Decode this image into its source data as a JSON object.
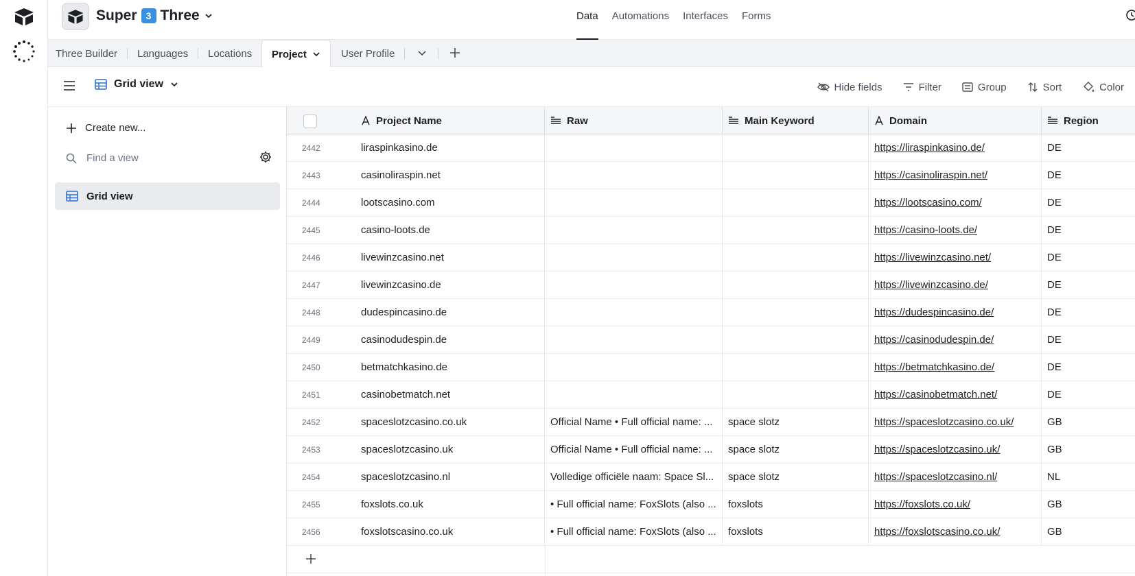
{
  "base": {
    "name_part1": "Super",
    "badge": "3",
    "name_part2": "Three"
  },
  "topnav": [
    "Data",
    "Automations",
    "Interfaces",
    "Forms"
  ],
  "tables": [
    "Three Builder",
    "Languages",
    "Locations",
    "Project",
    "User Profile"
  ],
  "active_table": "Project",
  "view": {
    "name": "Grid view"
  },
  "toolbar": {
    "hide_fields": "Hide fields",
    "filter": "Filter",
    "group": "Group",
    "sort": "Sort",
    "color": "Color"
  },
  "sidebar": {
    "create": "Create new...",
    "find_placeholder": "Find a view",
    "views": [
      "Grid view"
    ]
  },
  "columns": [
    "Project Name",
    "Raw",
    "Main Keyword",
    "Domain",
    "Region"
  ],
  "rows": [
    {
      "id": "2442",
      "name": "liraspinkasino.de",
      "raw": "",
      "kw": "",
      "domain": "https://liraspinkasino.de/",
      "region": "DE"
    },
    {
      "id": "2443",
      "name": "casinoliraspin.net",
      "raw": "",
      "kw": "",
      "domain": "https://casinoliraspin.net/",
      "region": "DE"
    },
    {
      "id": "2444",
      "name": "lootscasino.com",
      "raw": "",
      "kw": "",
      "domain": "https://lootscasino.com/",
      "region": "DE"
    },
    {
      "id": "2445",
      "name": "casino-loots.de",
      "raw": "",
      "kw": "",
      "domain": "https://casino-loots.de/",
      "region": "DE"
    },
    {
      "id": "2446",
      "name": "livewinzcasino.net",
      "raw": "",
      "kw": "",
      "domain": "https://livewinzcasino.net/",
      "region": "DE"
    },
    {
      "id": "2447",
      "name": "livewinzcasino.de",
      "raw": "",
      "kw": "",
      "domain": "https://livewinzcasino.de/",
      "region": "DE"
    },
    {
      "id": "2448",
      "name": "dudespincasino.de",
      "raw": "",
      "kw": "",
      "domain": "https://dudespincasino.de/",
      "region": "DE"
    },
    {
      "id": "2449",
      "name": "casinodudespin.de",
      "raw": "",
      "kw": "",
      "domain": "https://casinodudespin.de/",
      "region": "DE"
    },
    {
      "id": "2450",
      "name": "betmatchkasino.de",
      "raw": "",
      "kw": "",
      "domain": "https://betmatchkasino.de/",
      "region": "DE"
    },
    {
      "id": "2451",
      "name": "casinobetmatch.net",
      "raw": "",
      "kw": "",
      "domain": "https://casinobetmatch.net/",
      "region": "DE"
    },
    {
      "id": "2452",
      "name": "spaceslotzcasino.co.uk",
      "raw": "Official Name • Full official name: ...",
      "kw": "space slotz",
      "domain": "https://spaceslotzcasino.co.uk/",
      "region": "GB"
    },
    {
      "id": "2453",
      "name": "spaceslotzcasino.uk",
      "raw": "Official Name • Full official name: ...",
      "kw": "space slotz",
      "domain": "https://spaceslotzcasino.uk/",
      "region": "GB"
    },
    {
      "id": "2454",
      "name": "spaceslotzcasino.nl",
      "raw": "Volledige officiële naam: Space Sl...",
      "kw": "space slotz",
      "domain": "https://spaceslotzcasino.nl/",
      "region": "NL"
    },
    {
      "id": "2455",
      "name": "foxslots.co.uk",
      "raw": "• Full official name: FoxSlots (also ...",
      "kw": "foxslots",
      "domain": "https://foxslots.co.uk/",
      "region": "GB"
    },
    {
      "id": "2456",
      "name": "foxslotscasino.co.uk",
      "raw": "• Full official name: FoxSlots (also ...",
      "kw": "foxslots",
      "domain": "https://foxslotscasino.co.uk/",
      "region": "GB"
    }
  ],
  "colors": {
    "accent": "#1d1f25",
    "badge": "#3b8fe0",
    "tabbar_bg": "#f2f4f8",
    "header_bg": "#f5f6f8"
  }
}
